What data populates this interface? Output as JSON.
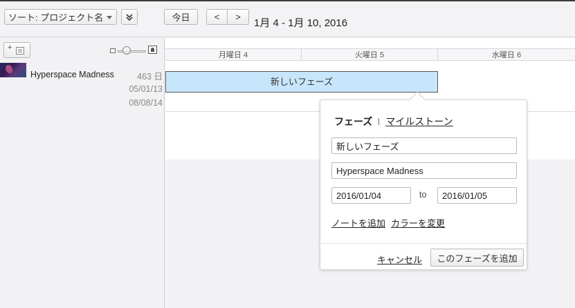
{
  "toolbar": {
    "sort_label": "ソート: プロジェクト名",
    "collapse_icon": "double-chevron-down-icon",
    "today_label": "今日",
    "prev_label": "<",
    "next_label": ">",
    "date_range": "1月 4 - 1月 10, 2016"
  },
  "sidebar": {
    "add_icon": "add-sheet-icon",
    "project": {
      "name": "Hyperspace Madness",
      "days": "463 日",
      "start": "05/01/13",
      "end": "08/08/14"
    }
  },
  "timeline": {
    "days": [
      "月曜日 4",
      "火曜日 5",
      "水曜日 6"
    ],
    "phase_bar_label": "新しいフェーズ",
    "phase_bar_color": "#c8e6fb"
  },
  "popover": {
    "tab_phase": "フェーズ",
    "tab_milestone": "マイルストーン",
    "name_value": "新しいフェーズ",
    "project_value": "Hyperspace Madness",
    "start_value": "2016/01/04",
    "to_label": "to",
    "end_value": "2016/01/05",
    "add_note": "ノートを追加",
    "change_color": "カラーを変更",
    "cancel": "キャンセル",
    "add_phase": "このフェーズを追加"
  }
}
